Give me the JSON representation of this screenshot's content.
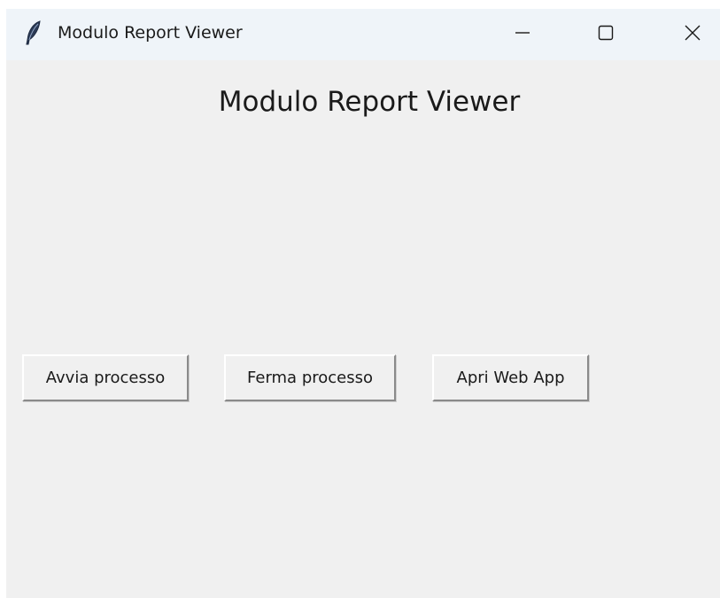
{
  "window": {
    "title": "Modulo Report Viewer",
    "controls": {
      "minimize": "minimize-icon",
      "maximize": "maximize-icon",
      "close": "close-icon"
    },
    "app_icon": "feather-icon"
  },
  "main": {
    "heading": "Modulo Report Viewer",
    "buttons": [
      {
        "label": "Avvia processo"
      },
      {
        "label": "Ferma processo"
      },
      {
        "label": "Apri Web App"
      }
    ]
  },
  "colors": {
    "background": "#f0f0f0",
    "titlebar": "#eff4f9",
    "text": "#1a1a1a"
  }
}
